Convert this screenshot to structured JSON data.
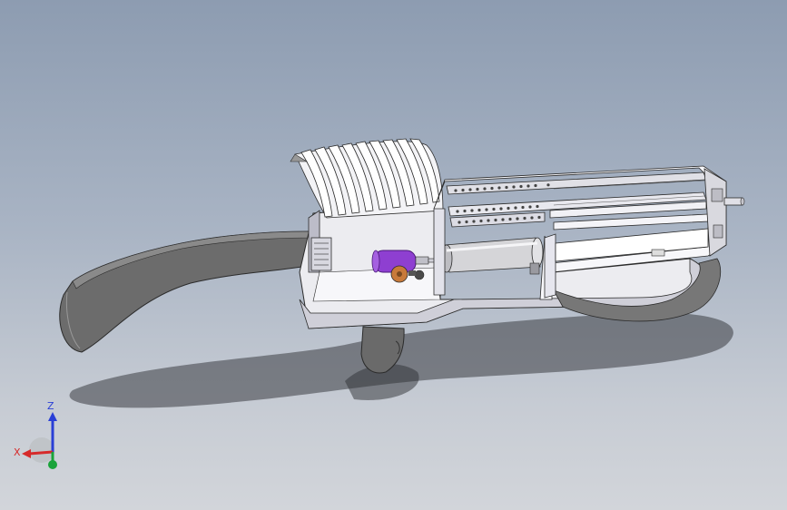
{
  "viewport": {
    "background_top": "#8d9cb1",
    "background_bottom": "#d2d5da"
  },
  "model": {
    "body_color": "#ffffff",
    "edge_color": "#2b2b2b",
    "shadow_color": "#3a3d42",
    "stock_color": "#6c6c6c",
    "motor_color": "#8e3fd1",
    "gear_color": "#c87a3a"
  },
  "triad": {
    "z_label": "Z",
    "x_label": "X",
    "z_color": "#2a3fd6",
    "x_color": "#d62a2a",
    "y_color": "#1aa33a"
  }
}
